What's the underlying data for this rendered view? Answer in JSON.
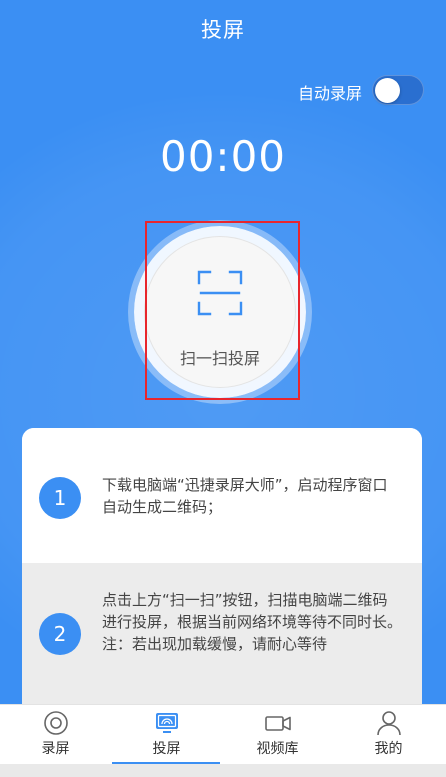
{
  "header": {
    "title": "投屏"
  },
  "auto_record": {
    "label": "自动录屏",
    "enabled": true
  },
  "timer": {
    "value": "00:00"
  },
  "scan": {
    "label": "扫一扫投屏"
  },
  "steps": [
    {
      "number": "1",
      "text": "下载电脑端“迅捷录屏大师”，启动程序窗口自动生成二维码；"
    },
    {
      "number": "2",
      "text": "点击上方“扫一扫”按钮，扫描电脑端二维码进行投屏，根据当前网络环境等待不同时长。 注：若出现加载缓慢，请耐心等待"
    }
  ],
  "tabs": [
    {
      "label": "录屏",
      "icon": "record-icon"
    },
    {
      "label": "投屏",
      "icon": "cast-icon",
      "active": true
    },
    {
      "label": "视频库",
      "icon": "video-camera-icon"
    },
    {
      "label": "我的",
      "icon": "user-icon"
    }
  ],
  "colors": {
    "primary": "#3b8ff3",
    "highlight": "#e8262d"
  }
}
